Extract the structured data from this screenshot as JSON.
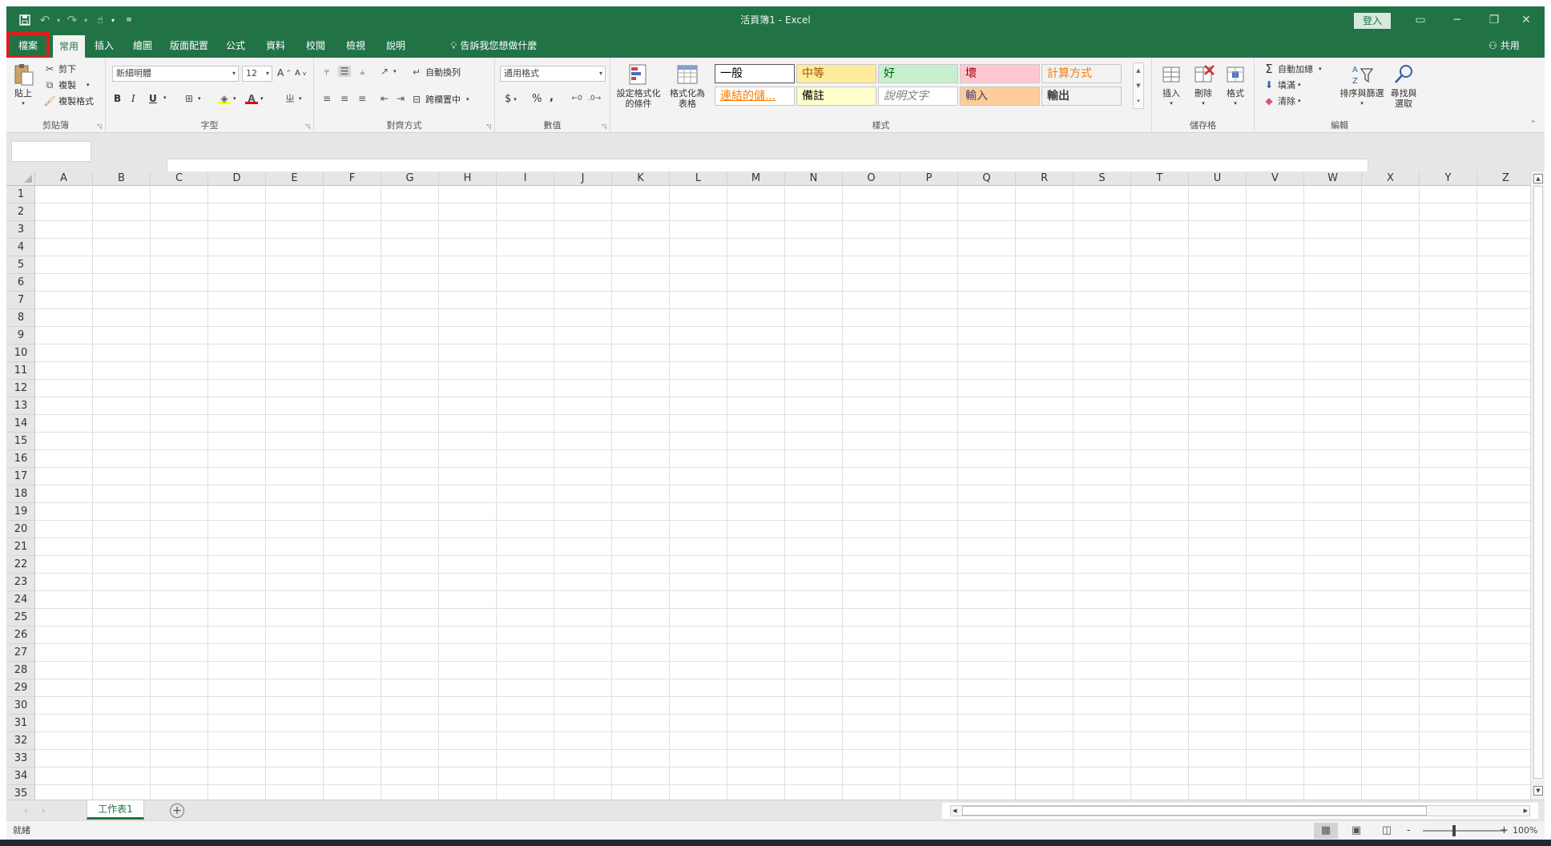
{
  "window": {
    "title": "活頁簿1 - Excel",
    "sign_in": "登入",
    "share": "共用",
    "icons": {
      "save": "save-icon",
      "undo": "undo-icon",
      "redo": "redo-icon",
      "touch": "touch-mode-icon",
      "customize": "customize-qat-icon"
    }
  },
  "tabs": [
    "檔案",
    "常用",
    "插入",
    "繪圖",
    "版面配置",
    "公式",
    "資料",
    "校閱",
    "檢視",
    "說明"
  ],
  "active_tab": "常用",
  "tell_me": "告訴我您想做什麼",
  "ribbon": {
    "clipboard": {
      "label": "剪貼簿",
      "paste": "貼上",
      "cut": "剪下",
      "copy": "複製",
      "format_painter": "複製格式"
    },
    "font": {
      "label": "字型",
      "font_name": "新細明體",
      "font_size": "12",
      "bold": "B",
      "italic": "I",
      "underline": "U",
      "font_color": "A"
    },
    "alignment": {
      "label": "對齊方式",
      "wrap_text": "自動換列",
      "merge_center": "跨欄置中"
    },
    "number": {
      "label": "數值",
      "format": "通用格式",
      "currency": "$",
      "percent": "%",
      "comma": ","
    },
    "styles": {
      "label": "樣式",
      "conditional": "設定格式化的條件",
      "format_table": "格式化為表格",
      "cells": [
        {
          "text": "一般",
          "bg": "#ffffff",
          "fg": "#000000"
        },
        {
          "text": "中等",
          "bg": "#ffeb9c",
          "fg": "#9c5700"
        },
        {
          "text": "好",
          "bg": "#c6efce",
          "fg": "#006100"
        },
        {
          "text": "壞",
          "bg": "#ffc7ce",
          "fg": "#9c0006"
        },
        {
          "text": "計算方式",
          "bg": "#f2f2f2",
          "fg": "#fa7d00"
        },
        {
          "text": "連結的儲...",
          "bg": "#ffffff",
          "fg": "#fa7d00"
        },
        {
          "text": "備註",
          "bg": "#ffffcc",
          "fg": "#000000"
        },
        {
          "text": "說明文字",
          "bg": "#ffffff",
          "fg": "#7f7f7f"
        },
        {
          "text": "輸入",
          "bg": "#ffcc99",
          "fg": "#3f3f76"
        },
        {
          "text": "輸出",
          "bg": "#f2f2f2",
          "fg": "#3f3f3f"
        }
      ]
    },
    "cells_group": {
      "label": "儲存格",
      "insert": "插入",
      "delete": "刪除",
      "format": "格式"
    },
    "editing": {
      "label": "編輯",
      "autosum": "自動加總",
      "fill": "填滿",
      "clear": "清除",
      "sort_filter": "排序與篩選",
      "find_select": "尋找與選取"
    }
  },
  "grid": {
    "columns": [
      "A",
      "B",
      "C",
      "D",
      "E",
      "F",
      "G",
      "H",
      "I",
      "J",
      "K",
      "L",
      "M",
      "N",
      "O",
      "P",
      "Q",
      "R",
      "S",
      "T",
      "U",
      "V",
      "W",
      "X",
      "Y",
      "Z"
    ],
    "rows": [
      "1",
      "2",
      "3",
      "4",
      "5",
      "6",
      "7",
      "8",
      "9",
      "10",
      "11",
      "12",
      "13",
      "14",
      "15",
      "16",
      "17",
      "18",
      "19",
      "20",
      "21",
      "22",
      "23",
      "24",
      "25",
      "26",
      "27",
      "28",
      "29",
      "30",
      "31",
      "32",
      "33",
      "34",
      "35"
    ]
  },
  "sheet_tabs": [
    "工作表1"
  ],
  "status": {
    "ready": "就緒",
    "zoom": "100%"
  },
  "accent_color": "#217346"
}
